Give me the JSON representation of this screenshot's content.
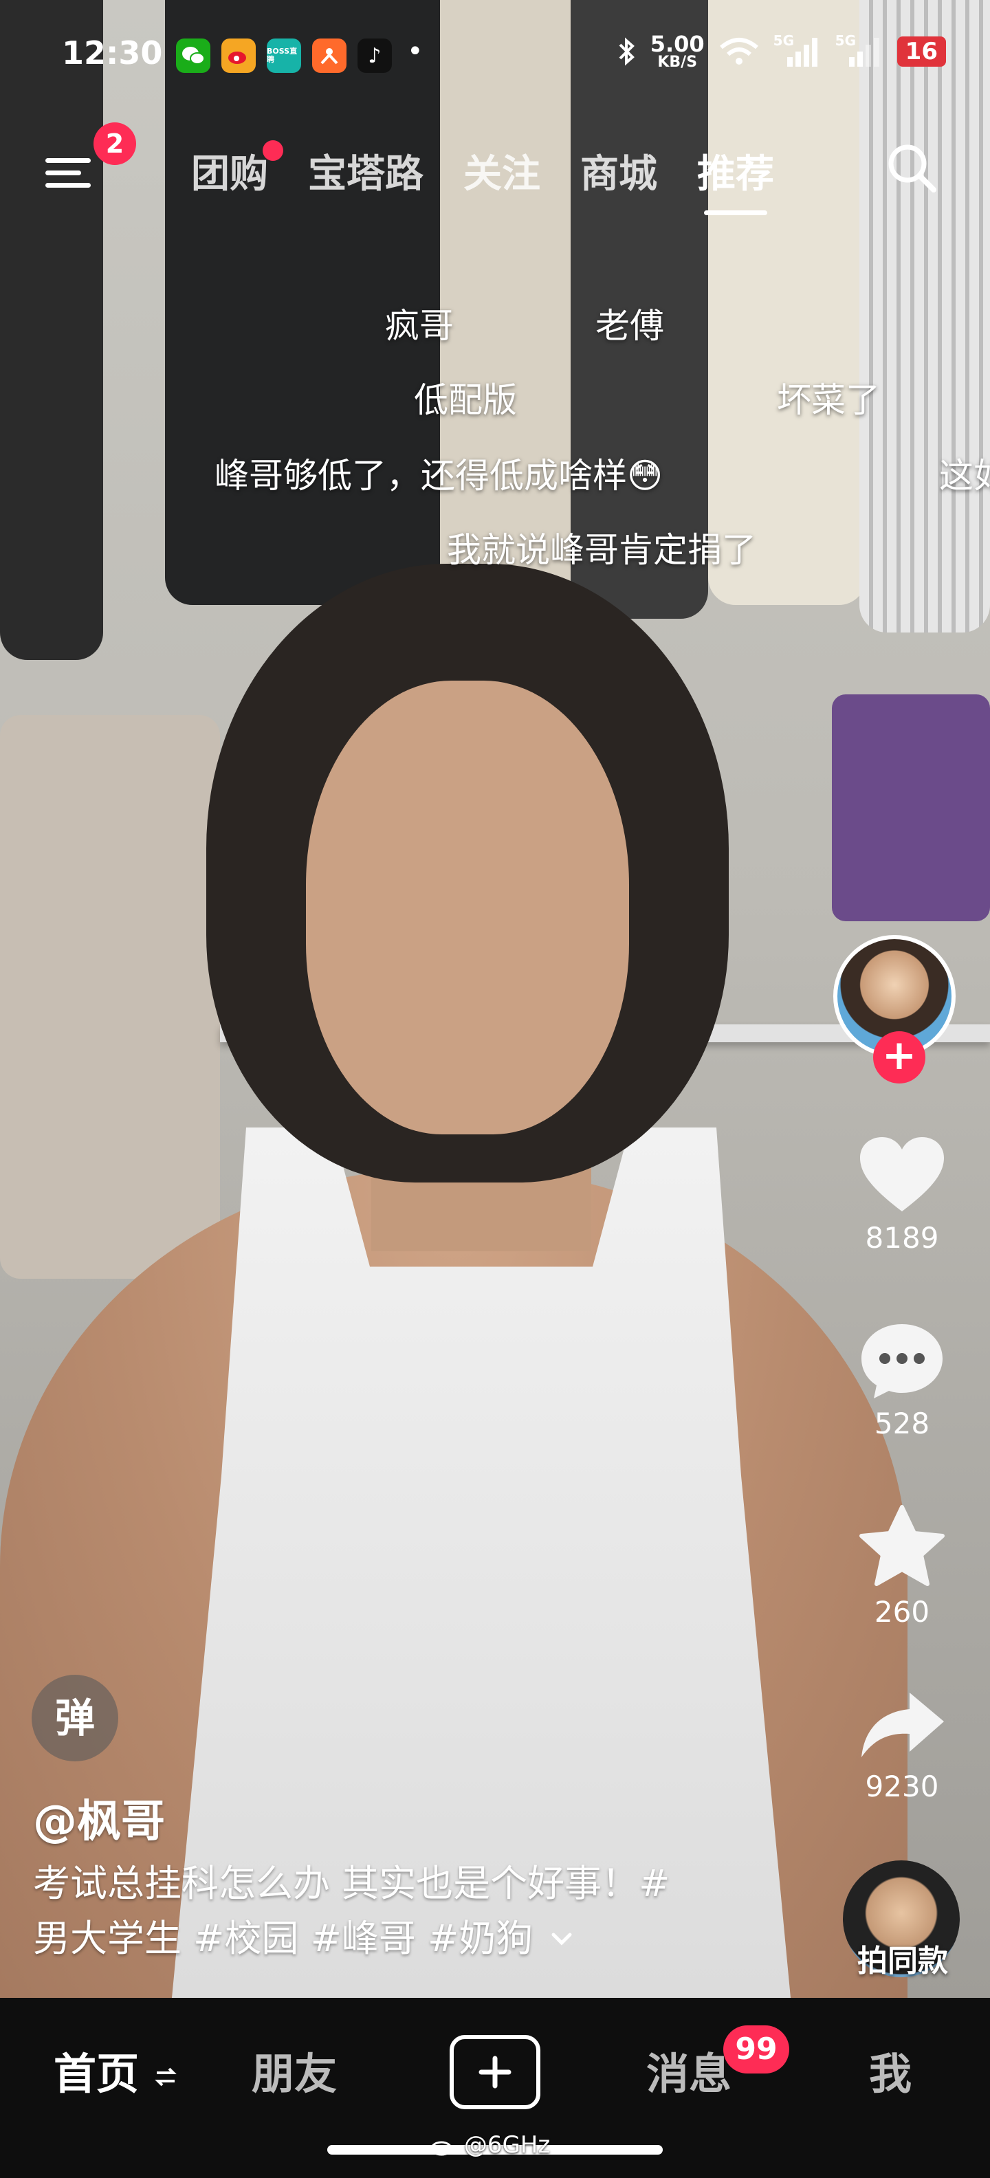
{
  "status_bar": {
    "time": "12:30",
    "app_icons": [
      {
        "name": "wechat-icon",
        "color": "#1aad19",
        "text": ""
      },
      {
        "name": "weibo-icon",
        "color": "#f5a623",
        "text": ""
      },
      {
        "name": "boss-zhipin-icon",
        "color": "#17b3a8",
        "text": "BOSS直聘"
      },
      {
        "name": "app-orange-icon",
        "color": "#ff6a2b",
        "text": ""
      },
      {
        "name": "tiktok-icon",
        "color": "#111111",
        "text": "♪"
      }
    ],
    "speed_value": "5.00",
    "speed_unit": "KB/S",
    "network": [
      "5G",
      "5G"
    ],
    "battery": "16"
  },
  "top_nav": {
    "menu_badge": "2",
    "tabs": [
      {
        "label": "团购",
        "has_dot": true
      },
      {
        "label": "宝塔路"
      },
      {
        "label": "关注"
      },
      {
        "label": "商城"
      },
      {
        "label": "推荐",
        "active": true
      }
    ]
  },
  "danmaku": [
    "疯哥",
    "老傅",
    "低配版",
    "坏菜了",
    "峰哥够低了，还得低成啥样😳",
    "这如",
    "我就说峰哥肯定捐了"
  ],
  "side_actions": {
    "likes": "8189",
    "comments": "528",
    "favorites": "260",
    "shares": "9230"
  },
  "danmaku_toggle": "弹",
  "author": "@枫哥",
  "caption_line1": "考试总挂科怎么办 其实也是个好事！#",
  "caption_line2": "男大学生 #校园 #峰哥 #奶狗",
  "same_style_label": "拍同款",
  "bottom_tabs": {
    "home": "首页",
    "friends": "朋友",
    "messages": "消息",
    "messages_badge": "99",
    "me": "我"
  },
  "watermark": "@6GHz",
  "colors": {
    "accent": "#fe2c55",
    "bottom_bar": "#0e0e0e"
  }
}
